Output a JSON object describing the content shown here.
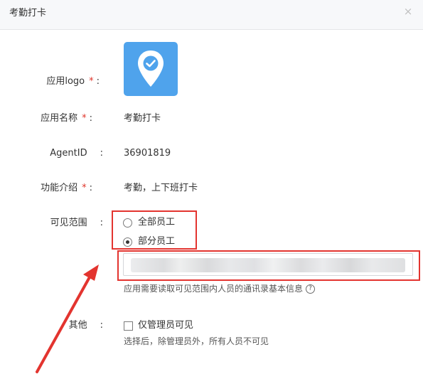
{
  "dialog": {
    "title": "考勤打卡",
    "close_glyph": "×"
  },
  "form": {
    "logo_label": "应用logo",
    "name_label": "应用名称",
    "name_value": "考勤打卡",
    "agentid_label": "AgentID",
    "agentid_value": "36901819",
    "intro_label": "功能介绍",
    "intro_value": "考勤，上下班打卡",
    "scope_label": "可见范围",
    "scope_options": [
      {
        "label": "全部员工",
        "selected": false
      },
      {
        "label": "部分员工",
        "selected": true
      }
    ],
    "scope_hint": "应用需要读取可见范围内人员的通讯录基本信息",
    "other_label": "其他",
    "admin_only_label": "仅管理员可见",
    "admin_only_checked": false,
    "admin_only_hint": "选择后，除管理员外，所有人员不可见",
    "required_mark": "*",
    "colon": ":",
    "help_glyph": "?"
  },
  "icons": {
    "logo_icon": "location-pin-check-icon",
    "close_icon": "close-icon",
    "help_icon": "question-circle-icon"
  },
  "colors": {
    "logo_bg": "#4fa3ec",
    "required": "#e0352b",
    "annotation_red": "#e3342f"
  }
}
